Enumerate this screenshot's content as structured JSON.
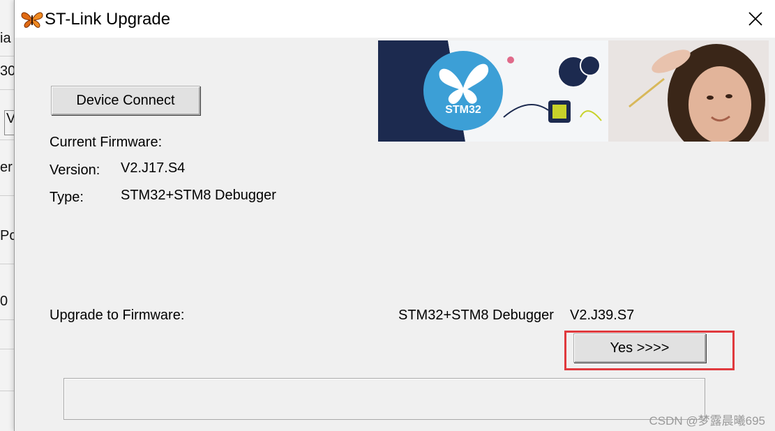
{
  "background_app": {
    "fragments": [
      "ia",
      "30",
      "V",
      "er",
      "Pc",
      "0"
    ]
  },
  "dialog": {
    "title": "ST-Link Upgrade",
    "icon": "butterfly-icon",
    "close_icon": "close-icon"
  },
  "device_connect": {
    "label": "Device Connect"
  },
  "current_firmware": {
    "heading": "Current Firmware:",
    "version_label": "Version:",
    "version_value": "V2.J17.S4",
    "type_label": "Type:",
    "type_value": "STM32+STM8 Debugger"
  },
  "banner": {
    "logo_text": "STM32"
  },
  "upgrade": {
    "label": "Upgrade to Firmware:",
    "target": "STM32+STM8 Debugger",
    "target_version": "V2.J39.S7",
    "yes_label": "Yes >>>>"
  },
  "progress": {
    "value": 0
  },
  "watermark": "CSDN @梦露晨曦695",
  "colors": {
    "highlight": "#e03a3e",
    "banner_navy": "#1c2a4f",
    "stm32_blue": "#3c9fd6"
  }
}
